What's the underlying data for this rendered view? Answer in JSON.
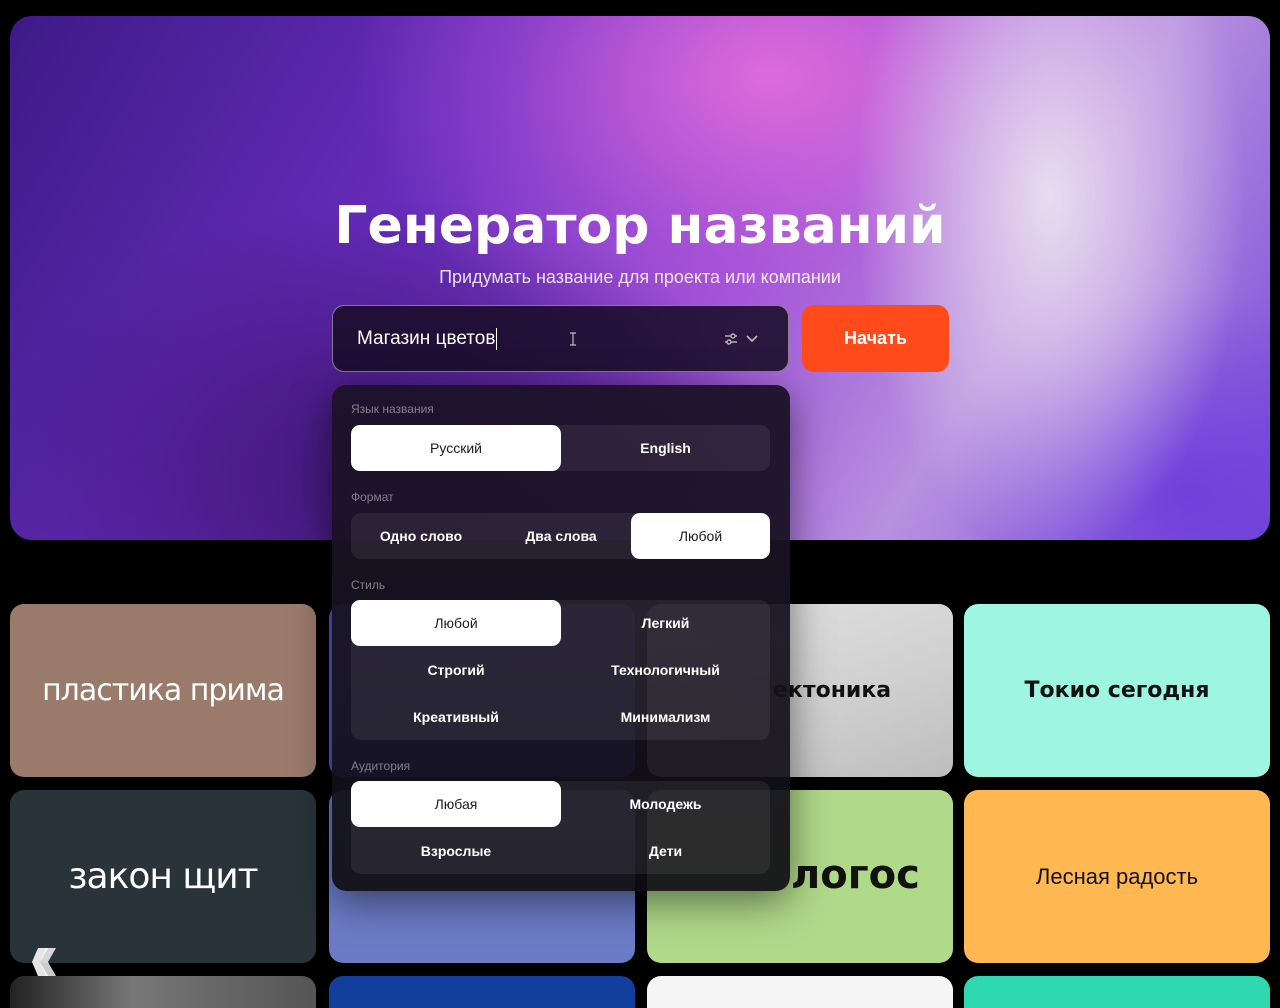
{
  "hero": {
    "title": "Генератор названий",
    "subtitle": "Придумать название для проекта или компании"
  },
  "search": {
    "value": "Магазин цветов",
    "filter_icon": "sliders-icon",
    "chevron_icon": "chevron-down-icon"
  },
  "start_button": {
    "label": "Начать",
    "color": "#ff4a1c"
  },
  "panel": {
    "language": {
      "label": "Язык названия",
      "options": [
        "Русский",
        "English"
      ],
      "selected": "Русский"
    },
    "format": {
      "label": "Формат",
      "options": [
        "Одно слово",
        "Два слова",
        "Любой"
      ],
      "selected": "Любой"
    },
    "style": {
      "label": "Стиль",
      "options": [
        "Любой",
        "Легкий",
        "Строгий",
        "Технологичный",
        "Креативный",
        "Минимализм"
      ],
      "selected": "Любой"
    },
    "audience": {
      "label": "Аудитория",
      "options": [
        "Любая",
        "Молодежь",
        "Взрослые",
        "Дети"
      ],
      "selected": "Любая"
    }
  },
  "tiles": [
    {
      "text": "пластика прима",
      "bg": "#9a7a6b",
      "color": "#ffffff"
    },
    {
      "text": "",
      "bg": "#4f56c8",
      "color": "#ffffff"
    },
    {
      "text": "ектоника",
      "bg": "#d8d8d8",
      "color": "#111111"
    },
    {
      "text": "Токио сегодня",
      "bg": "#9ef5e2",
      "color": "#111111"
    },
    {
      "text": "закон щит",
      "bg": "#28333a",
      "color": "#ffffff"
    },
    {
      "text": "",
      "bg": "#6b7bc6",
      "color": "#ffffff"
    },
    {
      "text": "логос",
      "bg": "#b0d98a",
      "color": "#111111"
    },
    {
      "text": "Лесная радость",
      "bg": "#ffb752",
      "color": "#111111"
    },
    {
      "text": "",
      "bg": "#3a3a3a",
      "color": "#ffffff"
    },
    {
      "text": "",
      "bg": "#123f9e",
      "color": "#ffffff"
    },
    {
      "text": "",
      "bg": "#f5f5f5",
      "color": "#111111"
    },
    {
      "text": "",
      "bg": "#2ed9b0",
      "color": "#111111"
    }
  ]
}
